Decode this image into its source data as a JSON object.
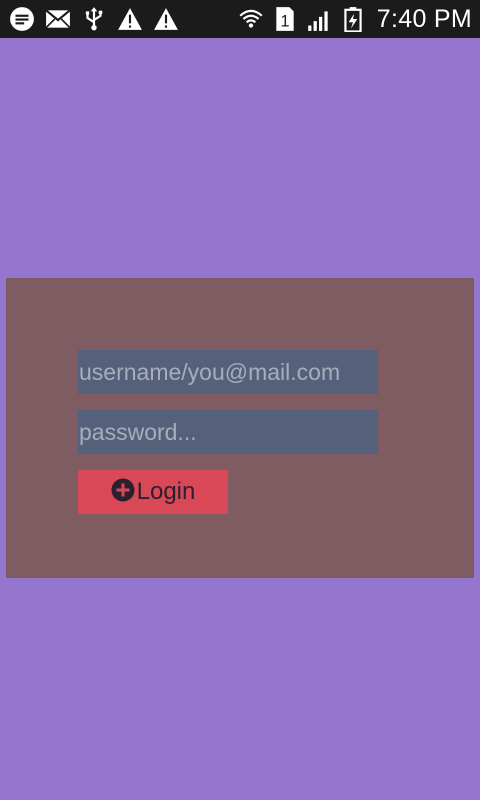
{
  "status_bar": {
    "time": "7:40 PM",
    "sim_slot": "1",
    "icons_left": [
      "message-icon",
      "mail-icon",
      "usb-icon",
      "warning-icon",
      "warning-icon"
    ],
    "icons_right": [
      "wifi-icon",
      "sim-icon",
      "signal-icon",
      "battery-charging-icon"
    ]
  },
  "login": {
    "username_placeholder": "username/you@mail.com",
    "password_placeholder": "password...",
    "button_label": "Login",
    "button_icon": "plus-circle-icon"
  },
  "colors": {
    "background": "#9575CD",
    "panel": "#7E5C62",
    "field": "#55607A",
    "button": "#D94856",
    "status_bar": "#1b1b1b"
  }
}
